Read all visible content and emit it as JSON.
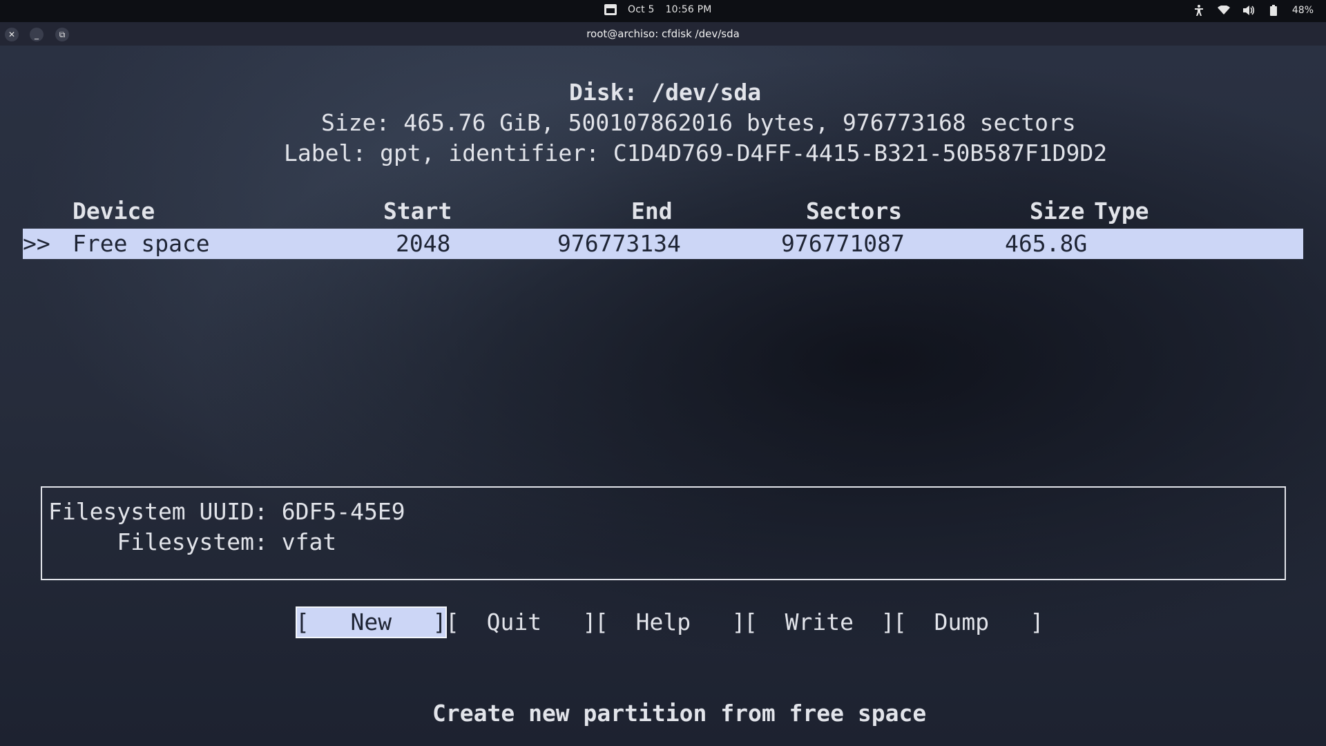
{
  "topbar": {
    "date": "Oct 5",
    "time": "10:56 PM",
    "battery": "48%",
    "icons": [
      "calendar-icon",
      "accessibility-icon",
      "wifi-icon",
      "volume-icon",
      "battery-icon"
    ]
  },
  "window": {
    "title": "root@archiso: cfdisk /dev/sda",
    "controls": [
      "close",
      "minimize",
      "restore"
    ]
  },
  "disk": {
    "heading": "Disk: /dev/sda",
    "size_line": "Size: 465.76 GiB, 500107862016 bytes, 976773168 sectors",
    "label_line": "Label: gpt, identifier: C1D4D769-D4FF-4415-B321-50B587F1D9D2"
  },
  "table": {
    "headers": {
      "device": "Device",
      "start": "Start",
      "end": "End",
      "sectors": "Sectors",
      "size": "Size",
      "type": "Type"
    },
    "rows": [
      {
        "marker": ">>",
        "device": "Free space",
        "start": "2048",
        "end": "976773134",
        "sectors": "976771087",
        "size": "465.8G",
        "type": ""
      }
    ]
  },
  "info": {
    "uuid_line": "Filesystem UUID: 6DF5-45E9",
    "fs_line": "     Filesystem: vfat"
  },
  "menu": {
    "items": [
      {
        "text": "[   New   ]",
        "active": true
      },
      {
        "text": "[  Quit   ]",
        "active": false
      },
      {
        "text": "[  Help   ]",
        "active": false
      },
      {
        "text": "[  Write  ]",
        "active": false
      },
      {
        "text": "[  Dump   ]",
        "active": false
      }
    ]
  },
  "status": "Create new partition from free space",
  "colors": {
    "selection_bg": "#ccd6f6",
    "text": "#e2e4ea"
  }
}
